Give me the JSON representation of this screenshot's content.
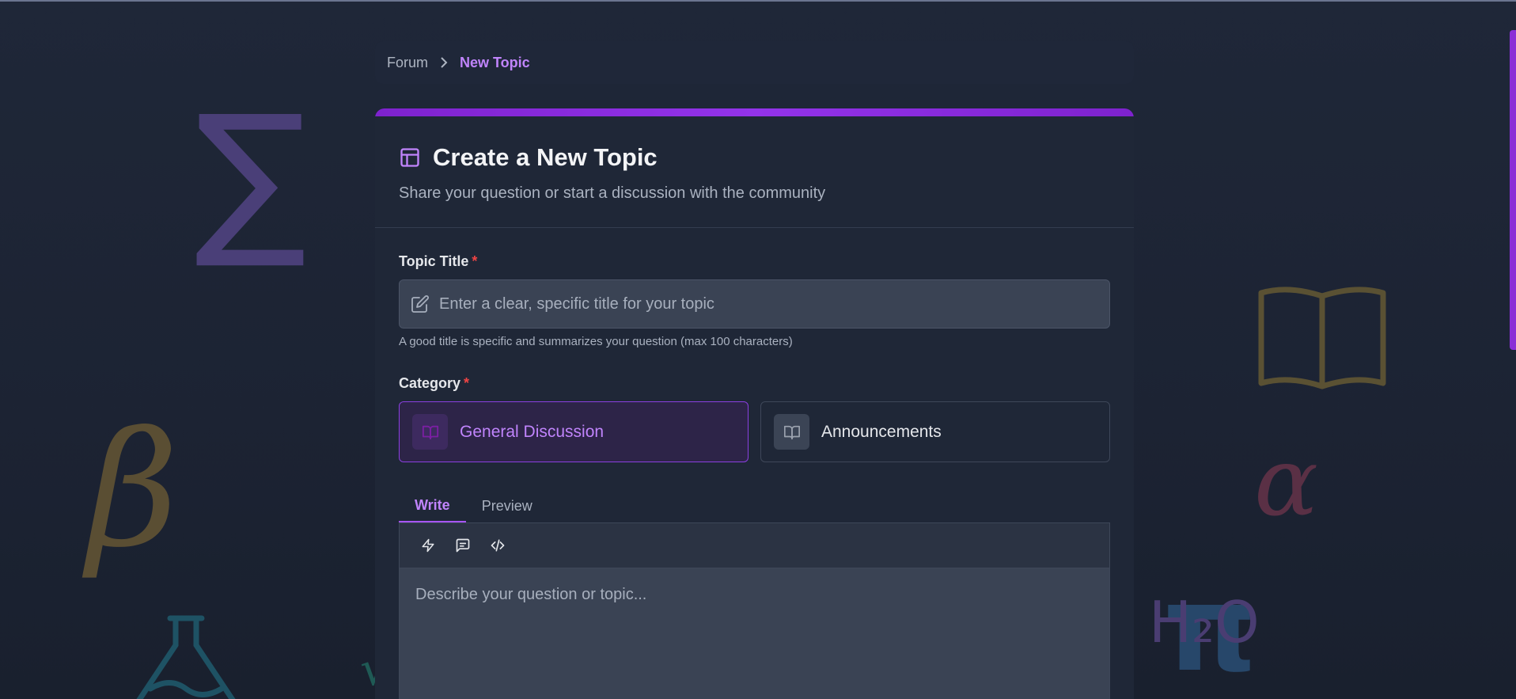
{
  "breadcrumb": {
    "items": [
      "Forum",
      "New Topic"
    ],
    "separator_icon": "chevron-right-icon"
  },
  "header": {
    "icon": "layout-icon",
    "title": "Create a New Topic",
    "subtitle": "Share your question or start a discussion with the community"
  },
  "topic_title": {
    "label": "Topic Title",
    "required_marker": "*",
    "icon": "edit-icon",
    "placeholder": "Enter a clear, specific title for your topic",
    "value": "",
    "hint": "A good title is specific and summarizes your question (max 100 characters)"
  },
  "category": {
    "label": "Category",
    "required_marker": "*",
    "options": [
      {
        "label": "General Discussion",
        "icon": "book-open-icon",
        "selected": true
      },
      {
        "label": "Announcements",
        "icon": "book-open-icon",
        "selected": false
      }
    ]
  },
  "editor": {
    "tabs": [
      {
        "label": "Write",
        "active": true
      },
      {
        "label": "Preview",
        "active": false
      }
    ],
    "toolbar": [
      "zap-icon",
      "message-square-icon",
      "code-icon"
    ],
    "placeholder": "Describe your question or topic...",
    "value": ""
  },
  "decorations": {
    "sigma": "∑",
    "beta": "β",
    "alpha": "α",
    "pi": "π",
    "h2o": "H₂O",
    "sqrt": "√"
  },
  "colors": {
    "accent": "#a855f7",
    "accent_text": "#c084fc",
    "required": "#ef4444",
    "background": "#1e2535"
  }
}
